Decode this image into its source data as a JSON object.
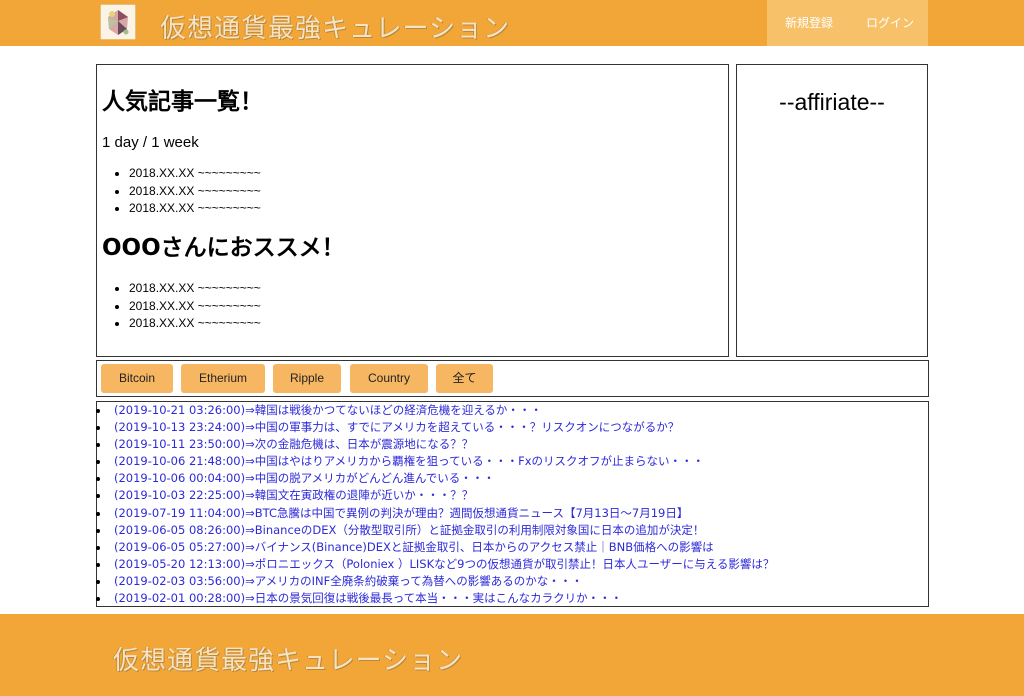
{
  "header": {
    "logo_icon": "crypto-coin-logo-icon",
    "title": "仮想通貨最強キュレーション",
    "nav": {
      "signup": "新規登録",
      "login": "ログイン"
    }
  },
  "main": {
    "popular_heading": "人気記事一覧！",
    "period_label": "1 day / 1 week",
    "popular_items": [
      "2018.XX.XX ~~~~~~~~~",
      "2018.XX.XX ~~~~~~~~~",
      "2018.XX.XX ~~~~~~~~~"
    ],
    "recommend_heading": "OOOさんにおススメ！",
    "recommend_items": [
      "2018.XX.XX ~~~~~~~~~",
      "2018.XX.XX ~~~~~~~~~",
      "2018.XX.XX ~~~~~~~~~"
    ]
  },
  "sidebar": {
    "affiliate_title": "--affiriate--"
  },
  "filters": [
    "Bitcoin",
    "Etherium",
    "Ripple",
    "Country",
    "全て"
  ],
  "news": [
    "(2019-10-21 03:26:00)⇒韓国は戦後かつてないほどの経済危機を迎えるか・・・",
    "(2019-10-13 23:24:00)⇒中国の軍事力は、すでにアメリカを超えている・・・？リスクオンにつながるか？",
    "(2019-10-11 23:50:00)⇒次の金融危機は、日本が震源地になる？？",
    "(2019-10-06 21:48:00)⇒中国はやはりアメリカから覇権を狙っている・・・Fxのリスクオフが止まらない・・・",
    "(2019-10-06 00:04:00)⇒中国の脱アメリカがどんどん進んでいる・・・",
    "(2019-10-03 22:25:00)⇒韓国文在寅政権の退陣が近いか・・・？？",
    "(2019-07-19 11:04:00)⇒BTC急騰は中国で異例の判決が理由？週間仮想通貨ニュース【7月13日〜7月19日】",
    "(2019-06-05 08:26:00)⇒BinanceのDEX（分散型取引所）と証拠金取引の利用制限対象国に日本の追加が決定！",
    "(2019-06-05 05:27:00)⇒バイナンス(Binance)DEXと証拠金取引、日本からのアクセス禁止｜BNB価格への影響は",
    "(2019-05-20 12:13:00)⇒ポロニエックス（Poloniex ）LISKなど9つの仮想通貨が取引禁止！日本人ユーザーに与える影響は？",
    "(2019-02-03 03:56:00)⇒アメリカのINF全廃条約破棄って為替への影響あるのかな・・・",
    "(2019-02-01 00:28:00)⇒日本の景気回復は戦後最長って本当・・・実はこんなカラクリか・・・"
  ],
  "footer": {
    "title": "仮想通貨最強キュレーション"
  },
  "colors": {
    "brand_orange": "#f2a637",
    "nav_bg": "#f7c169",
    "button_bg": "#f7b762",
    "link_blue": "#2d2ad8"
  }
}
